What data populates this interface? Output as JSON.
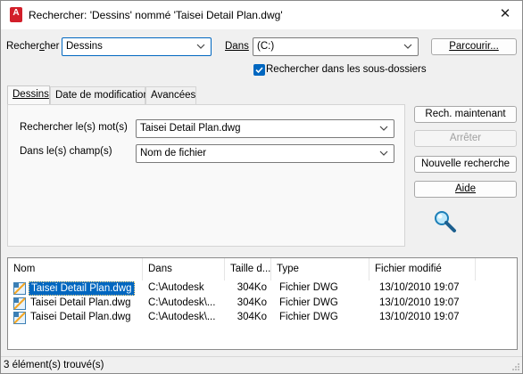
{
  "window": {
    "title": "Rechercher: 'Dessins' nommé 'Taisei Detail Plan.dwg'",
    "app_icon_letter": "A",
    "close_glyph": "✕"
  },
  "search": {
    "look_for_label_pre": "Recher",
    "look_for_label_key": "c",
    "look_for_label_post": "her",
    "look_for_value": "Dessins",
    "in_label": "Dans",
    "in_value": "(C:)",
    "browse_label": "Parcourir...",
    "subfolders_label": "Rechercher dans les sous-dossiers",
    "subfolders_checked": true
  },
  "tabs": [
    {
      "label": "Dessins",
      "active": true
    },
    {
      "label": "Date de modification",
      "active": false
    },
    {
      "label": "Avancées",
      "active": false
    }
  ],
  "drawings_tab": {
    "words_label": "Rechercher le(s) mot(s)",
    "words_value": "Taisei Detail Plan.dwg",
    "fields_label": "Dans le(s) champ(s)",
    "fields_value": "Nom de fichier"
  },
  "actions": {
    "search_now": "Rech. maintenant",
    "stop": "Arrêter",
    "new_search": "Nouvelle recherche",
    "help": "Aide"
  },
  "results": {
    "columns": [
      "Nom",
      "Dans",
      "Taille d...",
      "Type",
      "Fichier modifié"
    ],
    "rows": [
      {
        "name": "Taisei Detail Plan.dwg",
        "in": "C:\\Autodesk",
        "size": "304Ko",
        "type": "Fichier DWG",
        "modified": "13/10/2010 19:07",
        "selected": true
      },
      {
        "name": "Taisei Detail Plan.dwg",
        "in": "C:\\Autodesk\\...",
        "size": "304Ko",
        "type": "Fichier DWG",
        "modified": "13/10/2010 19:07",
        "selected": false
      },
      {
        "name": "Taisei Detail Plan.dwg",
        "in": "C:\\Autodesk\\...",
        "size": "304Ko",
        "type": "Fichier DWG",
        "modified": "13/10/2010 19:07",
        "selected": false
      }
    ]
  },
  "status": {
    "text": "3 élément(s) trouvé(s)"
  },
  "colors": {
    "accent": "#0067c0",
    "app_icon": "#d21f2a",
    "magnifier": "#2aa7df"
  },
  "icons": {
    "search_anim": "magnifier-icon",
    "file": "dwg-file-icon",
    "combo_arrow": "chevron-down-icon"
  }
}
